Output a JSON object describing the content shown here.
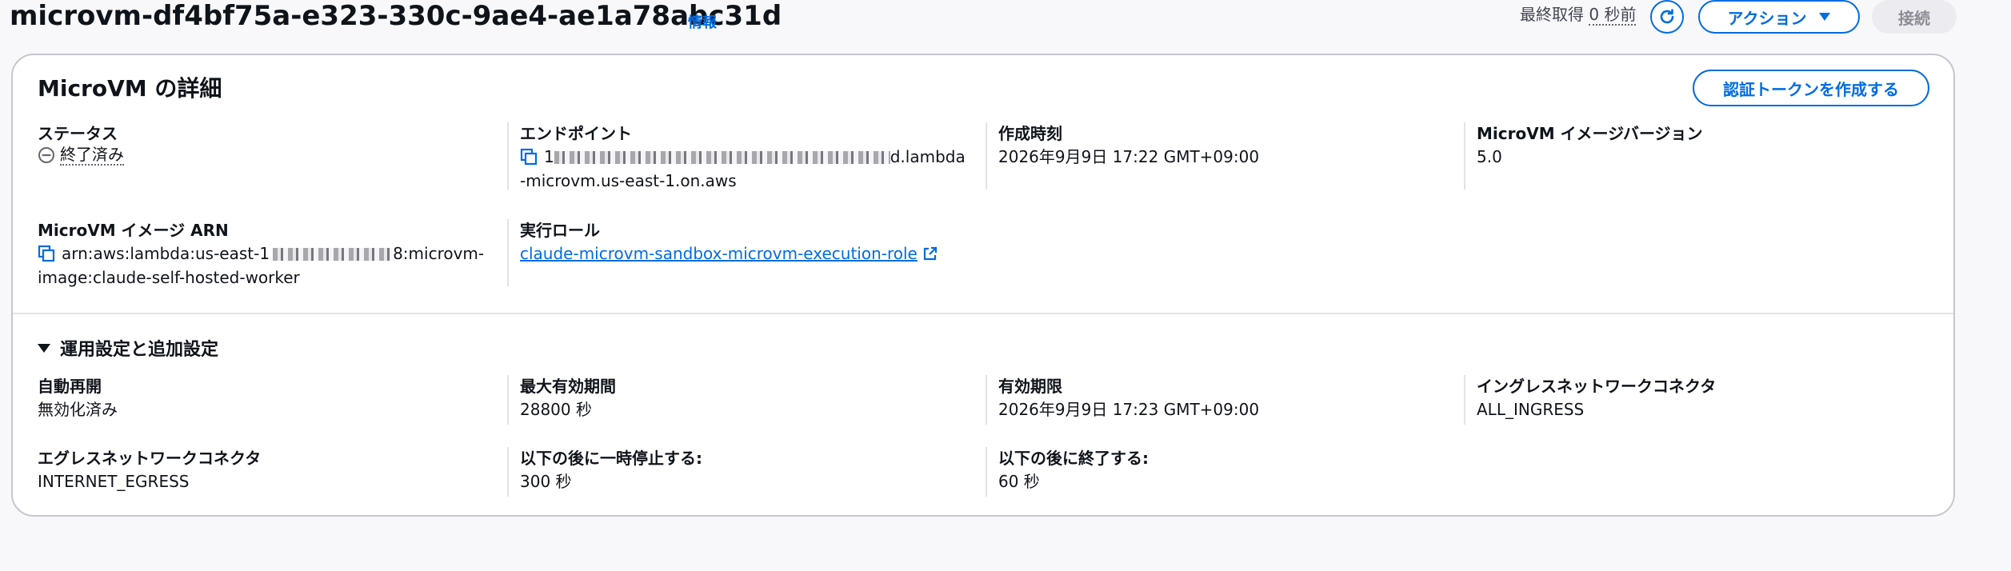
{
  "page": {
    "title": "microvm-df4bf75a-e323-330c-9ae4-ae1a78abc31d",
    "info_link": "情報"
  },
  "header": {
    "last_fetched_label": "最終取得",
    "last_fetched_value": "0 秒前",
    "actions_label": "アクション",
    "connect_label": "接続"
  },
  "details": {
    "title": "MicroVM の詳細",
    "create_token_label": "認証トークンを作成する",
    "status": {
      "label": "ステータス",
      "value": "終了済み"
    },
    "endpoint": {
      "label": "エンドポイント",
      "value_prefix": "1",
      "value_suffix": "d.lambda-microvm.us-east-1.on.aws"
    },
    "created_at": {
      "label": "作成時刻",
      "value": "2026年9月9日 17:22 GMT+09:00"
    },
    "image_version": {
      "label": "MicroVM イメージバージョン",
      "value": "5.0"
    },
    "image_arn": {
      "label": "MicroVM イメージ ARN",
      "value_prefix": "arn:aws:lambda:us-east-1",
      "value_suffix": "8:microvm-image:claude-self-hosted-worker"
    },
    "execution_role": {
      "label": "実行ロール",
      "value": "claude-microvm-sandbox-microvm-execution-role"
    }
  },
  "operational": {
    "section_title": "運用設定と追加設定",
    "auto_resume": {
      "label": "自動再開",
      "value": "無効化済み"
    },
    "max_lifetime": {
      "label": "最大有効期間",
      "value": "28800 秒"
    },
    "expiration": {
      "label": "有効期限",
      "value": "2026年9月9日 17:23 GMT+09:00"
    },
    "ingress_connector": {
      "label": "イングレスネットワークコネクタ",
      "value": "ALL_INGRESS"
    },
    "egress_connector": {
      "label": "エグレスネットワークコネクタ",
      "value": "INTERNET_EGRESS"
    },
    "pause_after": {
      "label": "以下の後に一時停止する:",
      "value": "300 秒"
    },
    "terminate_after": {
      "label": "以下の後に終了する:",
      "value": "60 秒"
    }
  },
  "colors": {
    "accent": "#006ce0",
    "border": "#c6c6cd",
    "muted_text": "#656871",
    "disabled_bg": "#ebebf0"
  },
  "icons": {
    "refresh": "refresh-icon",
    "caret": "caret-down-icon",
    "status": "stopped-status-icon",
    "copy": "copy-icon",
    "external": "external-link-icon",
    "expand": "expand-caret-icon"
  }
}
